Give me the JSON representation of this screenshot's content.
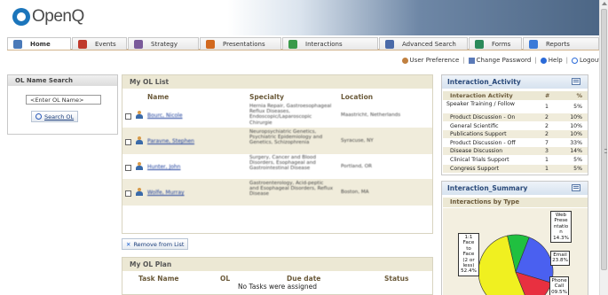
{
  "app": {
    "logo_text": "OpenQ"
  },
  "tabs": [
    {
      "label": "Home",
      "icon": "home-icon",
      "color": "#4a7ab8",
      "active": true
    },
    {
      "label": "Events",
      "icon": "calendar-icon",
      "color": "#c0392b",
      "active": false
    },
    {
      "label": "Strategy",
      "icon": "chart-icon",
      "color": "#7a5a9a",
      "active": false
    },
    {
      "label": "Presentations",
      "icon": "presentation-icon",
      "color": "#d2691e",
      "active": false
    },
    {
      "label": "Interactions",
      "icon": "handshake-icon",
      "color": "#3a9a4a",
      "active": false
    },
    {
      "label": "Advanced Search",
      "icon": "user-search-icon",
      "color": "#4a6aa8",
      "active": false
    },
    {
      "label": "Forms",
      "icon": "form-icon",
      "color": "#2a8a5a",
      "active": false
    },
    {
      "label": "Reports",
      "icon": "globe-icon",
      "color": "#3a7ad8",
      "active": false
    }
  ],
  "userlinks": {
    "preference": "User Preference",
    "password": "Change Password",
    "help": "Help",
    "logout": "Logout",
    "sep": "|"
  },
  "ol_search": {
    "title": "OL Name Search",
    "input_value": "<Enter OL Name>",
    "button": "Search OL"
  },
  "ol_list": {
    "title": "My OL List",
    "headers": {
      "name": "Name",
      "specialty": "Specialty",
      "location": "Location"
    },
    "rows": [
      {
        "name": "Bourc, Nicole",
        "specialty": "Hernia Repair, Gastroesophageal Reflux Diseases, Endoscopic/Laparoscopic Chirurgie",
        "location": "Maastricht, Netherlands"
      },
      {
        "name": "Paravne, Stephen",
        "specialty": "Neuropsychiatric Genetics, Psychiatric Epidemiology and Genetics, Schizophrenia",
        "location": "Syracuse, NY"
      },
      {
        "name": "Hunter, John",
        "specialty": "Surgery, Cancer and Blood Disorders, Esophageal and Gastrointestinal Disease",
        "location": "Portland, OR"
      },
      {
        "name": "Wolfe, Murray",
        "specialty": "Gastroenterology, Acid-peptic and Esophageal Disorders, Reflux Disease",
        "location": "Boston, MA"
      }
    ],
    "remove_button": "Remove from List"
  },
  "ol_plan": {
    "title": "My OL Plan",
    "headers": {
      "task": "Task Name",
      "ol": "OL",
      "due": "Due date",
      "status": "Status"
    },
    "empty": "No Tasks were assigned"
  },
  "interaction_activity": {
    "title": "Interaction_Activity",
    "headers": {
      "activity": "Interaction Activity",
      "count": "#",
      "pct": "%"
    },
    "rows": [
      {
        "activity": "Speaker Training / Follow",
        "count": "1",
        "pct": "5%"
      },
      {
        "activity": "Product Discussion - On",
        "count": "2",
        "pct": "10%"
      },
      {
        "activity": "General Scientific",
        "count": "2",
        "pct": "10%"
      },
      {
        "activity": "Publications Support",
        "count": "2",
        "pct": "10%"
      },
      {
        "activity": "Product Discussion - Off",
        "count": "7",
        "pct": "33%"
      },
      {
        "activity": "Disease Discussion",
        "count": "3",
        "pct": "14%"
      },
      {
        "activity": "Clinical Trials Support",
        "count": "1",
        "pct": "5%"
      },
      {
        "activity": "Congress Support",
        "count": "1",
        "pct": "5%"
      }
    ]
  },
  "interaction_summary": {
    "title": "Interaction_Summary",
    "subtitle": "Interactions by Type"
  },
  "chart_data": {
    "type": "pie",
    "slices": [
      {
        "label": "1:1 Face to Face (2 or less)",
        "value": 52.4,
        "color": "#f0f020",
        "display": "1:1\nFace\nto\nFace\n(2 or\nless)\n52.4%"
      },
      {
        "label": "Phone Call",
        "value": 9.5,
        "color": "#20c040",
        "display": "Phone\nCall\n09.5%"
      },
      {
        "label": "Email",
        "value": 23.8,
        "color": "#4a60f0",
        "display": "Email\n23.8%"
      },
      {
        "label": "Web Presentation",
        "value": 14.3,
        "color": "#e83040",
        "display": "Web\nPrese\nntatio\nn 14.3%"
      }
    ]
  }
}
